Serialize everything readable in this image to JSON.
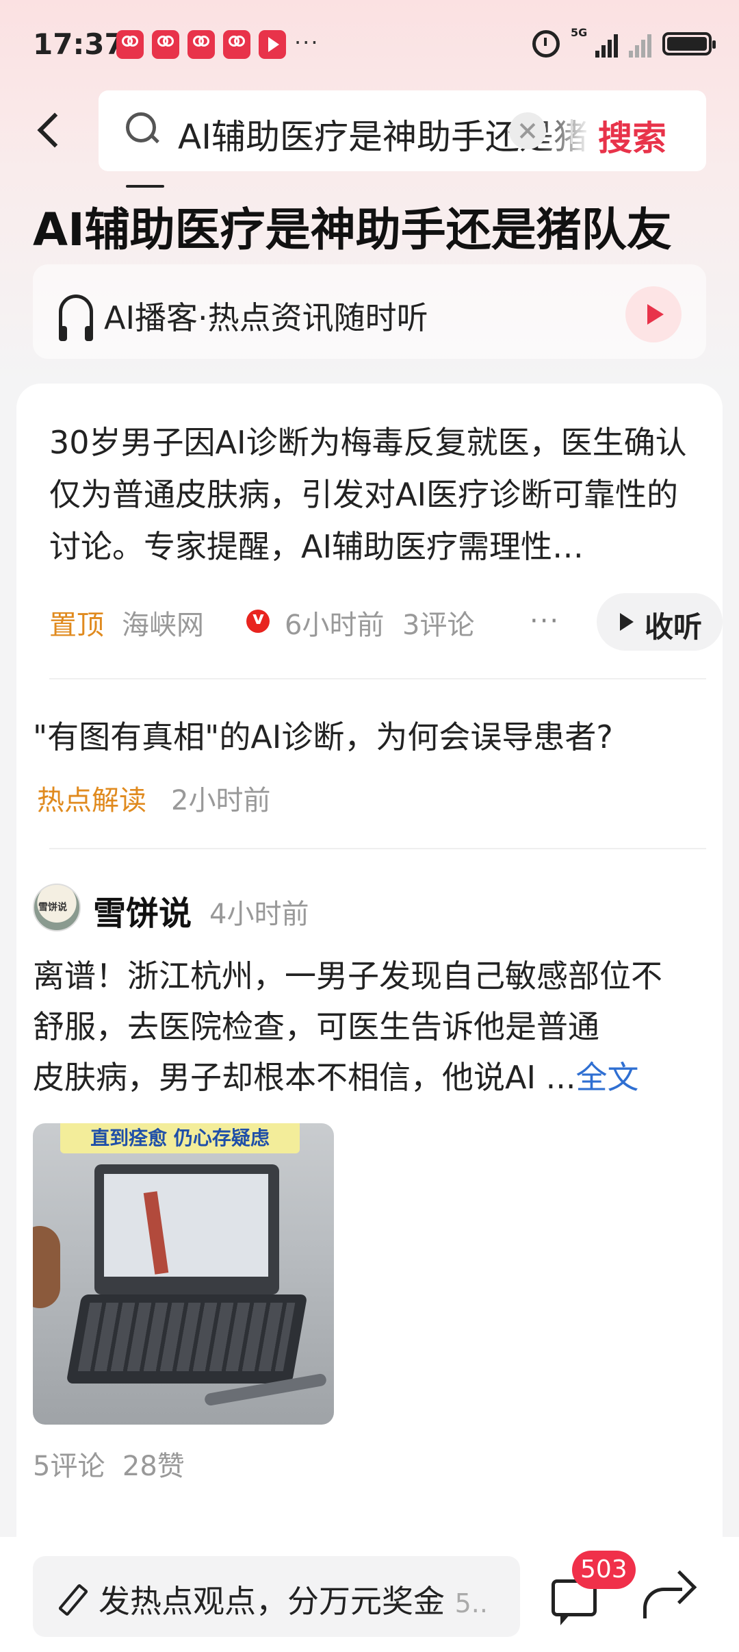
{
  "status_bar": {
    "time": "17:37",
    "network": "5G",
    "more": "···"
  },
  "search": {
    "query": "AI辅助医疗是神助手还是猪队友",
    "button_label": "搜索"
  },
  "header": {
    "title": "AI辅助医疗是神助手还是猪队友",
    "podcast_label": "AI播客·热点资讯随时听"
  },
  "article": {
    "abstract": "30岁男子因AI诊断为梅毒反复就医，医生确认仅为普通皮肤病，引发对AI医疗诊断可靠性的讨论。专家提醒，AI辅助医疗需理性…",
    "pinned_tag": "置顶",
    "source": "海峡网",
    "time": "6小时前",
    "comments": "3评论",
    "more": "···",
    "listen_label": "收听"
  },
  "related": {
    "title": "\"有图有真相\"的AI诊断，为何会误导患者?",
    "tag": "热点解读",
    "time": "2小时前"
  },
  "post": {
    "avatar_text": "雪饼说",
    "author": "雪饼说",
    "time": "4小时前",
    "text_lines": "离谱！浙江杭州，一男子发现自己敏感部位不舒服，去医院检查，可医生告诉他是普通",
    "text_last": "皮肤病，男子却根本不相信，他说AI ...",
    "fulltext_label": "全文",
    "image_caption": "直到痊愈 仍心存疑虑",
    "comments": "5评论",
    "likes": "28赞"
  },
  "bottom_bar": {
    "placeholder": "发热点观点，分万元奖金",
    "placeholder_suffix": "5..",
    "comment_count": "503"
  },
  "colors": {
    "accent": "#e8334a",
    "tag_orange": "#e08a1e",
    "link_blue": "#2f6fd2"
  }
}
